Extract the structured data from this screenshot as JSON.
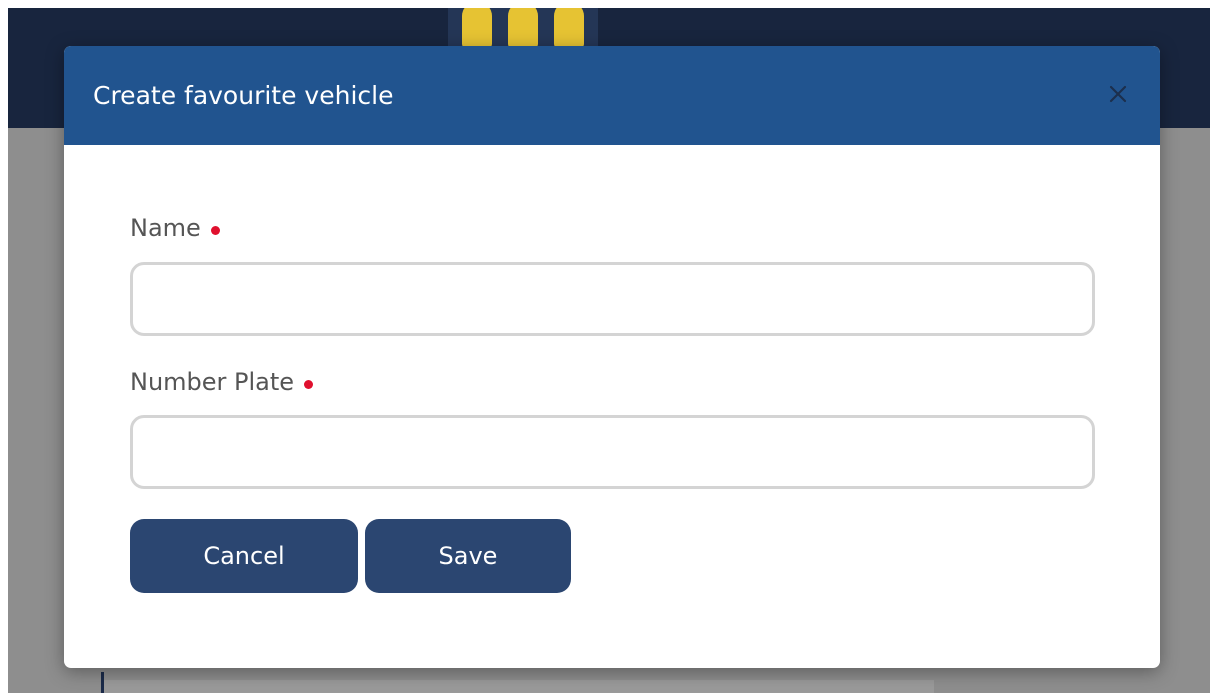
{
  "modal": {
    "title": "Create favourite vehicle",
    "close_icon": "close-icon"
  },
  "form": {
    "name_label": "Name",
    "name_value": "",
    "name_placeholder": "",
    "plate_label": "Number Plate",
    "plate_value": "",
    "plate_placeholder": "",
    "required_indicator_color": "#e0102e"
  },
  "actions": {
    "cancel_label": "Cancel",
    "save_label": "Save"
  },
  "colors": {
    "modal_header": "#21548f",
    "button": "#2b4671",
    "app_header": "#18253e"
  }
}
